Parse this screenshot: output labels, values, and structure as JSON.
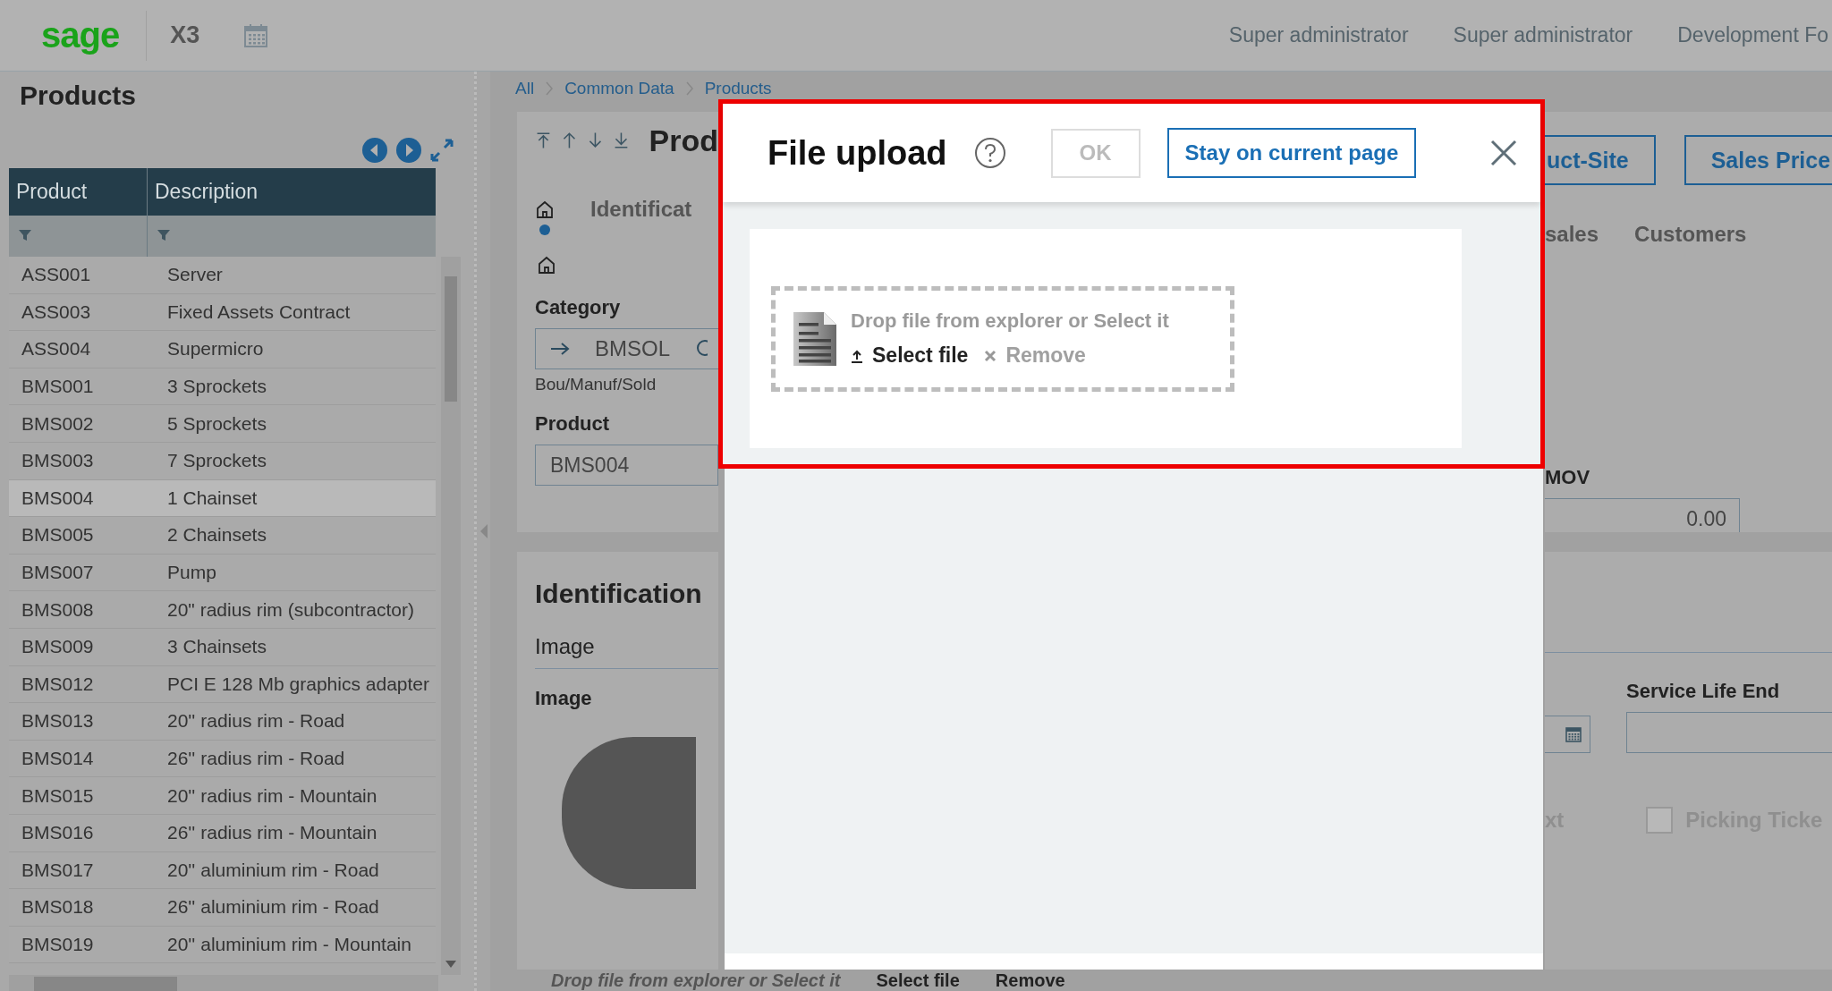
{
  "top_bar": {
    "logo": "sage",
    "app": "X3",
    "user_items": [
      "Super administrator",
      "Super administrator",
      "Development Fo"
    ]
  },
  "products_panel": {
    "title": "Products",
    "table": {
      "columns": [
        "Product",
        "Description"
      ],
      "rows": [
        {
          "product": "ASS001",
          "description": "Server",
          "selected": false
        },
        {
          "product": "ASS003",
          "description": "Fixed Assets Contract",
          "selected": false
        },
        {
          "product": "ASS004",
          "description": "Supermicro",
          "selected": false
        },
        {
          "product": "BMS001",
          "description": "3 Sprockets",
          "selected": false
        },
        {
          "product": "BMS002",
          "description": "5 Sprockets",
          "selected": false
        },
        {
          "product": "BMS003",
          "description": "7 Sprockets",
          "selected": false
        },
        {
          "product": "BMS004",
          "description": "1 Chainset",
          "selected": true
        },
        {
          "product": "BMS005",
          "description": "2 Chainsets",
          "selected": false
        },
        {
          "product": "BMS007",
          "description": "Pump",
          "selected": false
        },
        {
          "product": "BMS008",
          "description": "20\" radius rim (subcontractor)",
          "selected": false
        },
        {
          "product": "BMS009",
          "description": "3 Chainsets",
          "selected": false
        },
        {
          "product": "BMS012",
          "description": "PCI E 128 Mb graphics adapter",
          "selected": false
        },
        {
          "product": "BMS013",
          "description": "20'' radius rim - Road",
          "selected": false
        },
        {
          "product": "BMS014",
          "description": "26'' radius rim - Road",
          "selected": false
        },
        {
          "product": "BMS015",
          "description": "20'' radius rim - Mountain",
          "selected": false
        },
        {
          "product": "BMS016",
          "description": "26'' radius rim - Mountain",
          "selected": false
        },
        {
          "product": "BMS017",
          "description": "20'' aluminium rim - Road",
          "selected": false
        },
        {
          "product": "BMS018",
          "description": "26'' aluminium rim - Road",
          "selected": false
        },
        {
          "product": "BMS019",
          "description": "20'' aluminium rim - Mountain",
          "selected": false
        }
      ]
    }
  },
  "breadcrumb": [
    "All",
    "Common Data",
    "Products"
  ],
  "record": {
    "title": "Prod",
    "buttons": [
      "uct-Site",
      "Sales Price"
    ],
    "tabs_left": [
      {
        "kind": "home",
        "selected": true
      },
      {
        "kind": "text",
        "label": "Identificat",
        "selected": false
      }
    ],
    "tabs_right": [
      {
        "kind": "text",
        "label": "sales",
        "selected": false
      },
      {
        "kind": "text",
        "label": "Customers",
        "selected": false
      }
    ],
    "category": {
      "label": "Category",
      "value": "BMSOL",
      "caption": "Bou/Manuf/Sold"
    },
    "product": {
      "label": "Product",
      "value": "BMS004"
    },
    "mov": {
      "label": "MOV",
      "value": "0.00"
    }
  },
  "identification": {
    "title": "Identification",
    "subtitle": "Image",
    "image_label": "Image",
    "service_life_end_label": "Service Life End",
    "fragment": "xt",
    "picking_ticket": {
      "label": "Picking Ticke",
      "checked": false
    },
    "drop_text": "Drop file from explorer or Select it",
    "select_file": "Select file",
    "remove": "Remove"
  },
  "dialog": {
    "title": "File upload",
    "ok": {
      "label": "OK",
      "disabled": true
    },
    "stay_button": "Stay on current page",
    "drop_zone": {
      "text": "Drop file from explorer or Select it",
      "select_file": "Select file",
      "remove": "Remove"
    }
  }
}
